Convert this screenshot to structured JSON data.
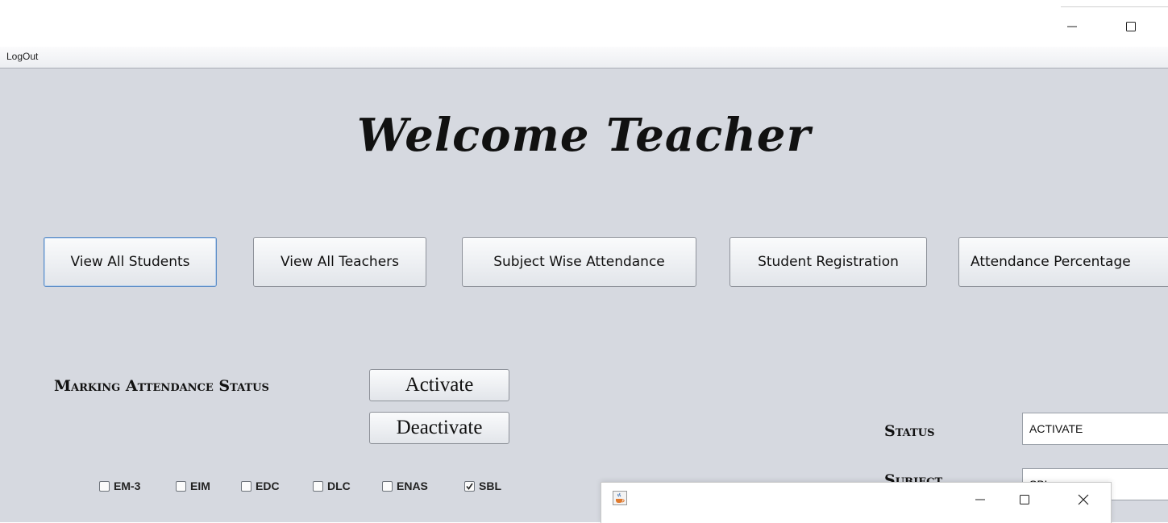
{
  "menubar": {
    "logout_label": "LogOut"
  },
  "welcome": {
    "title": "Welcome Teacher"
  },
  "nav_buttons": [
    {
      "label": "View All Students"
    },
    {
      "label": "View All Teachers"
    },
    {
      "label": "Subject Wise Attendance"
    },
    {
      "label": "Student Registration"
    },
    {
      "label": "Attendance Percentage"
    }
  ],
  "marking": {
    "label": "Marking Attendance Status",
    "activate_label": "Activate",
    "deactivate_label": "Deactivate"
  },
  "status": {
    "label": "Status",
    "value": "ACTIVATE"
  },
  "subject": {
    "label": "Subject",
    "value": "SBL"
  },
  "subjects": [
    {
      "label": "EM-3",
      "checked": false
    },
    {
      "label": "EIM",
      "checked": false
    },
    {
      "label": "EDC",
      "checked": false
    },
    {
      "label": "DLC",
      "checked": false
    },
    {
      "label": "ENAS",
      "checked": false
    },
    {
      "label": "SBL",
      "checked": true
    }
  ],
  "icons": {
    "minimize": "minimize-icon",
    "maximize": "maximize-icon",
    "close": "close-icon",
    "java": "java-cup-icon"
  }
}
